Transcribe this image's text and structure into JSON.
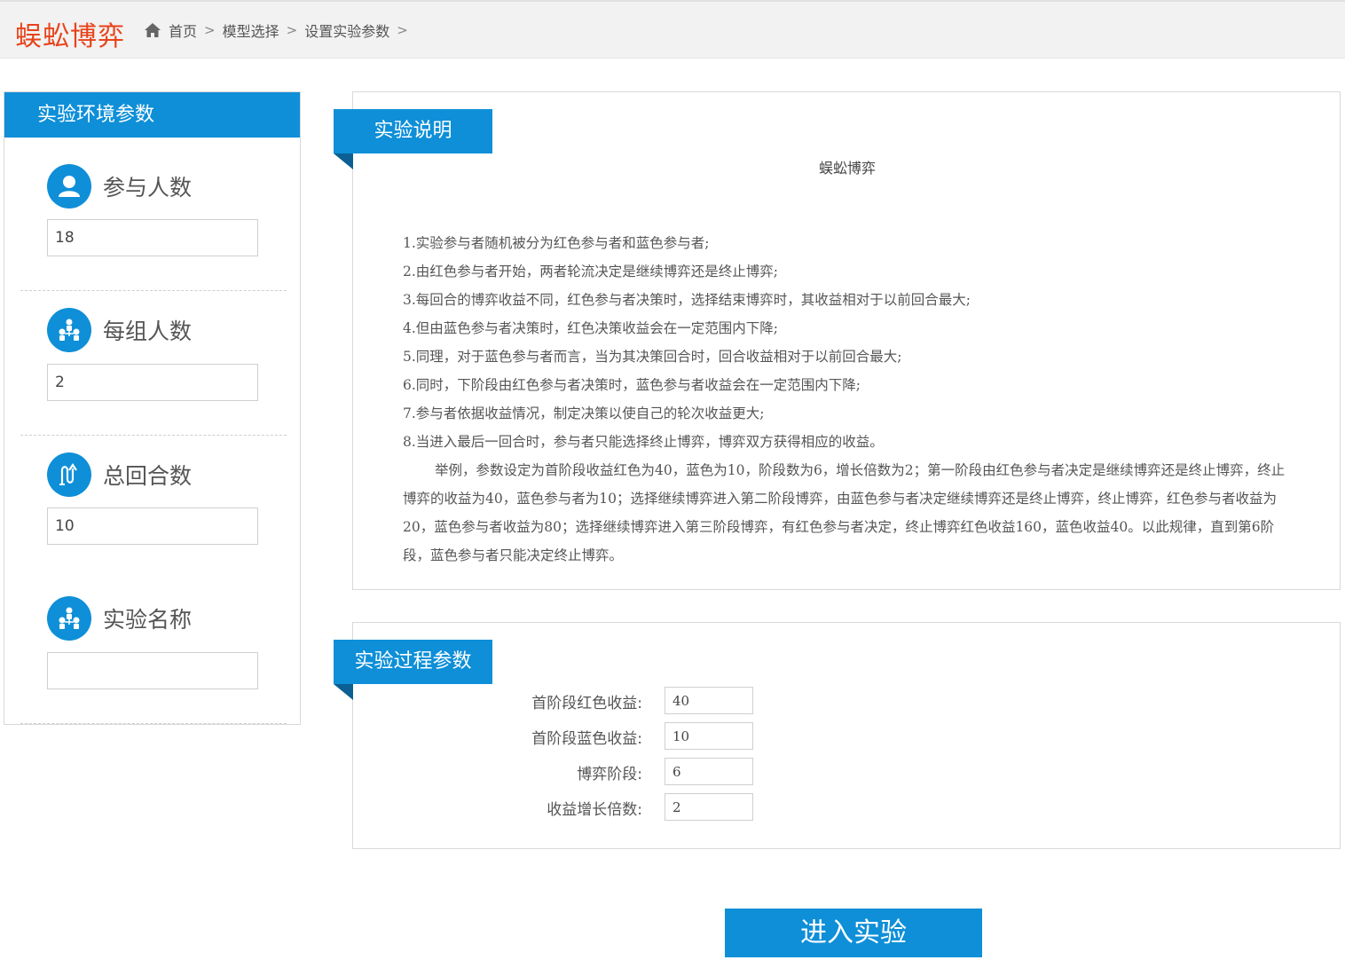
{
  "header": {
    "logo": "蜈蚣博弈",
    "breadcrumb": [
      "首页",
      "模型选择",
      "设置实验参数"
    ],
    "separator": ">"
  },
  "env_panel": {
    "title": "实验环境参数",
    "params": [
      {
        "icon": "user-icon",
        "label": "参与人数",
        "value": "18"
      },
      {
        "icon": "group-icon",
        "label": "每组人数",
        "value": "2"
      },
      {
        "icon": "rounds-icon",
        "label": "总回合数",
        "value": "10"
      },
      {
        "icon": "group-icon",
        "label": "实验名称",
        "value": ""
      }
    ]
  },
  "explain": {
    "ribbon": "实验说明",
    "title": "蜈蚣博弈",
    "rules": [
      "1.实验参与者随机被分为红色参与者和蓝色参与者;",
      "2.由红色参与者开始，两者轮流决定是继续博弈还是终止博弈;",
      "3.每回合的博弈收益不同，红色参与者决策时，选择结束博弈时，其收益相对于以前回合最大;",
      "4.但由蓝色参与者决策时，红色决策收益会在一定范围内下降;",
      "5.同理，对于蓝色参与者而言，当为其决策回合时，回合收益相对于以前回合最大;",
      "6.同时，下阶段由红色参与者决策时，蓝色参与者收益会在一定范围内下降;",
      "7.参与者依据收益情况，制定决策以使自己的轮次收益更大;",
      "8.当进入最后一回合时，参与者只能选择终止博弈，博弈双方获得相应的收益。"
    ],
    "example": "举例，参数设定为首阶段收益红色为40，蓝色为10，阶段数为6，增长倍数为2；第一阶段由红色参与者决定是继续博弈还是终止博弈，终止博弈的收益为40，蓝色参与者为10；选择继续博弈进入第二阶段博弈，由蓝色参与者决定继续博弈还是终止博弈，终止博弈，红色参与者收益为20，蓝色参与者收益为80；选择继续博弈进入第三阶段博弈，有红色参与者决定，终止博弈红色收益160，蓝色收益40。以此规律，直到第6阶段，蓝色参与者只能决定终止博弈。"
  },
  "process": {
    "ribbon": "实验过程参数",
    "fields": [
      {
        "label": "首阶段红色收益:",
        "value": "40"
      },
      {
        "label": "首阶段蓝色收益:",
        "value": "10"
      },
      {
        "label": "博弈阶段:",
        "value": "6"
      },
      {
        "label": "收益增长倍数:",
        "value": "2"
      }
    ]
  },
  "actions": {
    "enter": "进入实验"
  },
  "colors": {
    "accent": "#0e8fd8",
    "logo": "#e8431a"
  }
}
